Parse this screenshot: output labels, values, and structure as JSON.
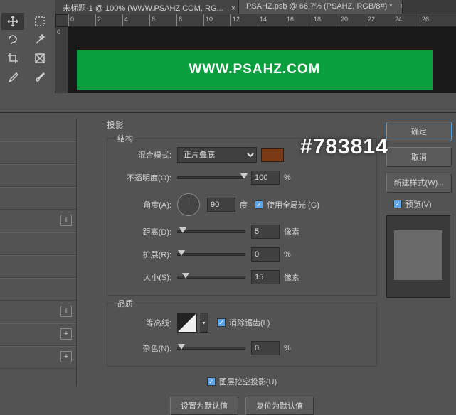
{
  "tabs": [
    {
      "label": "未标题-1 @ 100% (WWW.PSAHZ.COM, RG..."
    },
    {
      "label": "PSAHZ.psb @ 66.7% (PSAHZ, RGB/8#) *"
    }
  ],
  "tab_close": "×",
  "ruler": [
    "0",
    "2",
    "4",
    "6",
    "8",
    "10",
    "12",
    "14",
    "16",
    "18",
    "20",
    "22",
    "24",
    "26"
  ],
  "ruler_v": "0",
  "banner_text": "WWW.PSAHZ.COM",
  "overlay": "#783814",
  "panel": {
    "title": "投影",
    "structure_label": "结构",
    "blend_mode_label": "混合模式:",
    "blend_mode_value": "正片叠底",
    "swatch_color": "#7a3a16",
    "opacity_label": "不透明度(O):",
    "opacity_value": "100",
    "opacity_unit": "%",
    "angle_label": "角度(A):",
    "angle_value": "90",
    "angle_unit": "度",
    "global_light": "使用全局光 (G)",
    "distance_label": "距离(D):",
    "distance_value": "5",
    "distance_unit": "像素",
    "spread_label": "扩展(R):",
    "spread_value": "0",
    "spread_unit": "%",
    "size_label": "大小(S):",
    "size_value": "15",
    "size_unit": "像素",
    "quality_label": "品质",
    "contour_label": "等高线:",
    "antialias": "消除锯齿(L)",
    "noise_label": "杂色(N):",
    "noise_value": "0",
    "noise_unit": "%",
    "knockout": "图层挖空投影(U)",
    "btn_default": "设置为默认值",
    "btn_reset": "复位为默认值"
  },
  "right": {
    "ok": "确定",
    "cancel": "取消",
    "new_style": "新建样式(W)...",
    "preview": "预览(V)"
  },
  "plus": "+"
}
